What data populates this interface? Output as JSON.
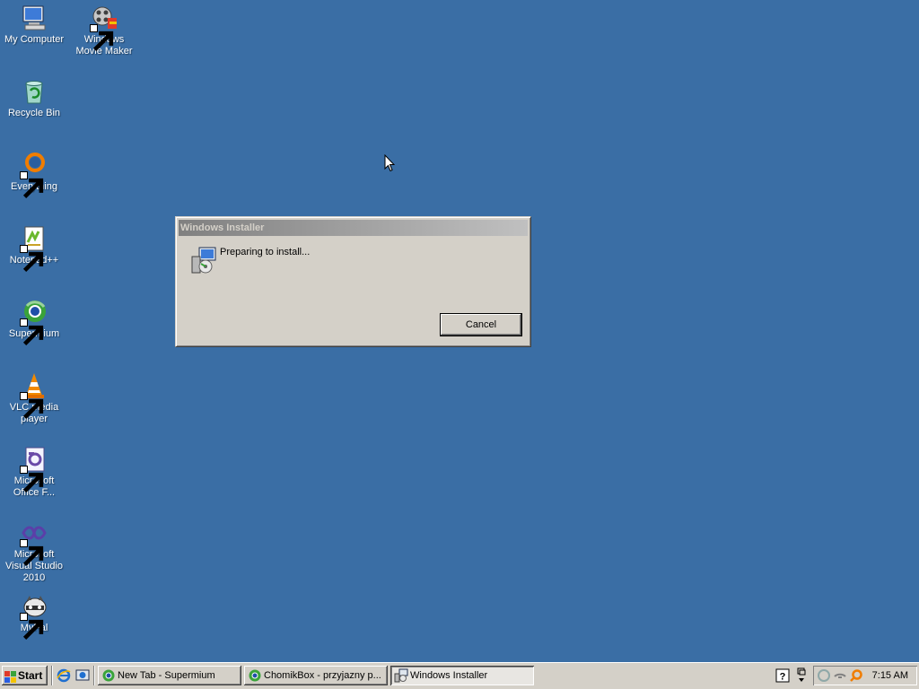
{
  "desktop": {
    "icons": [
      {
        "label": "My Computer",
        "icon": "my-computer-icon"
      },
      {
        "label": "Windows Movie Maker",
        "icon": "movie-maker-icon"
      },
      {
        "label": "Recycle Bin",
        "icon": "recycle-bin-icon"
      },
      {
        "label": "Everything",
        "icon": "everything-search-icon"
      },
      {
        "label": "Notepad++",
        "icon": "notepad-plus-plus-icon"
      },
      {
        "label": "Supermium",
        "icon": "supermium-browser-icon"
      },
      {
        "label": "VLC media player",
        "icon": "vlc-cone-icon"
      },
      {
        "label": "Microsoft Office F...",
        "icon": "office-file-icon"
      },
      {
        "label": "Microsoft Visual Studio 2010",
        "icon": "visual-studio-icon"
      },
      {
        "label": "MyPal",
        "icon": "mypal-raccoon-icon"
      }
    ]
  },
  "dialog": {
    "title": "Windows Installer",
    "message": "Preparing to install...",
    "cancel_label": "Cancel"
  },
  "taskbar": {
    "start_label": "Start",
    "tasks": [
      {
        "label": "New Tab - Supermium",
        "icon": "supermium-browser-icon"
      },
      {
        "label": "ChomikBox - przyjazny p...",
        "icon": "chomikbox-icon"
      },
      {
        "label": "Windows Installer",
        "icon": "installer-icon"
      }
    ],
    "clock": "7:15 AM"
  },
  "colors": {
    "desktop_background": "#3a6ea5",
    "window_face": "#d4d0c8",
    "inactive_title_start": "#808080",
    "inactive_title_end": "#c0c0c0"
  }
}
